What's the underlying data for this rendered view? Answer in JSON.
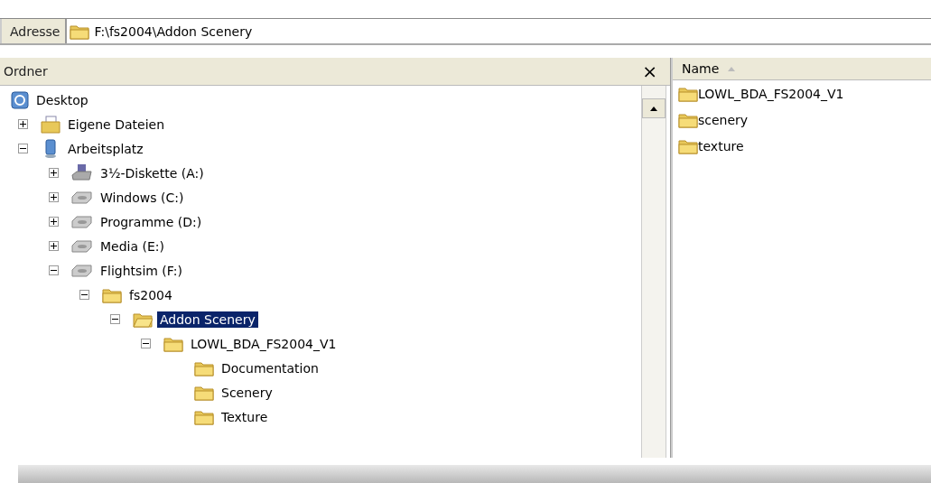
{
  "address_bar": {
    "label": "Adresse",
    "value": "F:\\fs2004\\Addon Scenery"
  },
  "folder_pane": {
    "title": "Ordner",
    "close": "×",
    "tree": [
      {
        "label": "Desktop",
        "kind": "desktop",
        "selected": false,
        "children": [
          {
            "label": "Eigene Dateien",
            "kind": "documents",
            "expanded": false,
            "selected": false
          },
          {
            "label": "Arbeitsplatz",
            "kind": "computer",
            "expanded": true,
            "selected": false,
            "children": [
              {
                "label": "3½-Diskette (A:)",
                "kind": "floppy",
                "expanded": false,
                "selected": false
              },
              {
                "label": "Windows (C:)",
                "kind": "drive",
                "expanded": false,
                "selected": false
              },
              {
                "label": "Programme (D:)",
                "kind": "drive",
                "expanded": false,
                "selected": false
              },
              {
                "label": "Media (E:)",
                "kind": "drive",
                "expanded": false,
                "selected": false
              },
              {
                "label": "Flightsim (F:)",
                "kind": "drive",
                "expanded": true,
                "selected": false,
                "children": [
                  {
                    "label": "fs2004",
                    "kind": "folder",
                    "expanded": true,
                    "selected": false,
                    "children": [
                      {
                        "label": "Addon Scenery",
                        "kind": "folder",
                        "expanded": true,
                        "selected": true,
                        "children": [
                          {
                            "label": "LOWL_BDA_FS2004_V1",
                            "kind": "folder",
                            "expanded": true,
                            "selected": false,
                            "children": [
                              {
                                "label": "Documentation",
                                "kind": "folder",
                                "selected": false
                              },
                              {
                                "label": "Scenery",
                                "kind": "folder",
                                "selected": false
                              },
                              {
                                "label": "Texture",
                                "kind": "folder",
                                "selected": false
                              }
                            ]
                          }
                        ]
                      }
                    ]
                  }
                ]
              }
            ]
          }
        ]
      }
    ]
  },
  "file_list": {
    "columns": [
      {
        "label": "Name",
        "sorted": true
      }
    ],
    "items": [
      {
        "name": "LOWL_BDA_FS2004_V1"
      },
      {
        "name": "scenery"
      },
      {
        "name": "texture"
      }
    ]
  }
}
